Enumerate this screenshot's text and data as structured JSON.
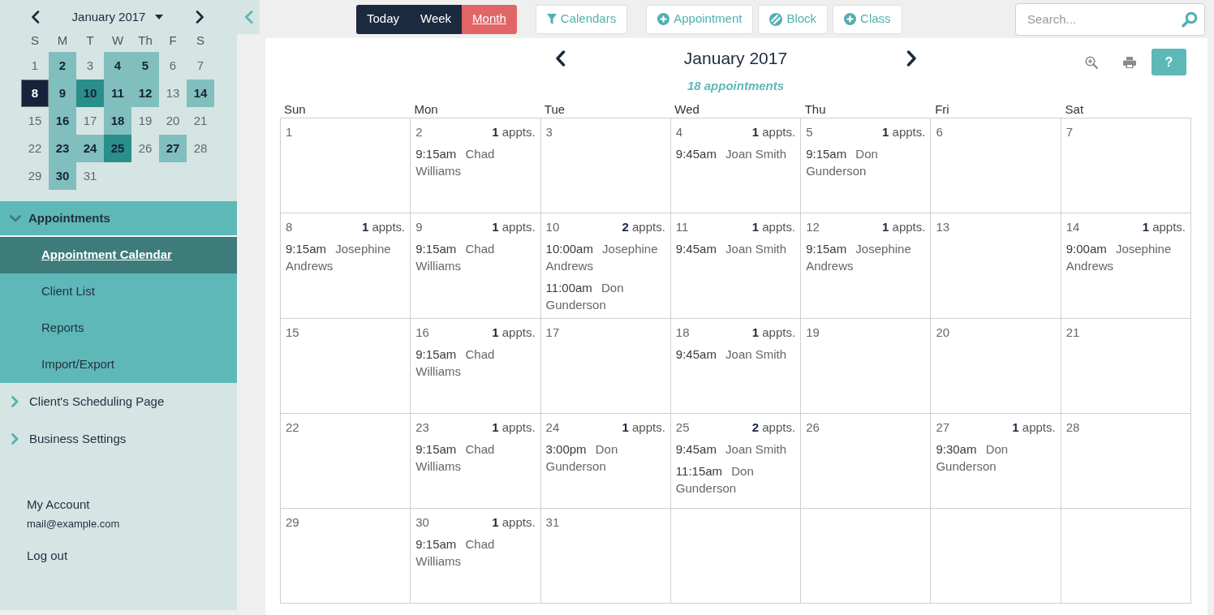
{
  "mini_calendar": {
    "title": "January 2017",
    "weekdays": [
      "S",
      "M",
      "T",
      "W",
      "Th",
      "F",
      "S"
    ],
    "days": [
      {
        "day": "1",
        "selected": false
      },
      {
        "day": "2",
        "selected": false,
        "color": "#80bfbd"
      },
      {
        "day": "3",
        "selected": false
      },
      {
        "day": "4",
        "selected": false,
        "color": "#80bfbd"
      },
      {
        "day": "5",
        "selected": false,
        "color": "#80bfbd"
      },
      {
        "day": "6",
        "selected": false
      },
      {
        "day": "7",
        "selected": false
      },
      {
        "day": "8",
        "selected": true
      },
      {
        "day": "9",
        "selected": false,
        "color": "#80bfbd"
      },
      {
        "day": "10",
        "selected": false,
        "color": "#2a8e8a"
      },
      {
        "day": "11",
        "selected": false,
        "color": "#80bfbd"
      },
      {
        "day": "12",
        "selected": false,
        "color": "#80bfbd"
      },
      {
        "day": "13",
        "selected": false
      },
      {
        "day": "14",
        "selected": false,
        "color": "#80bfbd"
      },
      {
        "day": "15",
        "selected": false
      },
      {
        "day": "16",
        "selected": false,
        "color": "#80bfbd"
      },
      {
        "day": "17",
        "selected": false
      },
      {
        "day": "18",
        "selected": false,
        "color": "#80bfbd"
      },
      {
        "day": "19",
        "selected": false
      },
      {
        "day": "20",
        "selected": false
      },
      {
        "day": "21",
        "selected": false
      },
      {
        "day": "22",
        "selected": false
      },
      {
        "day": "23",
        "selected": false,
        "color": "#80bfbd"
      },
      {
        "day": "24",
        "selected": false,
        "color": "#80bfbd"
      },
      {
        "day": "25",
        "selected": false,
        "color": "#2a8e8a"
      },
      {
        "day": "26",
        "selected": false
      },
      {
        "day": "27",
        "selected": false,
        "color": "#80bfbd"
      },
      {
        "day": "28",
        "selected": false
      },
      {
        "day": "29",
        "selected": false
      },
      {
        "day": "30",
        "selected": false,
        "color": "#80bfbd"
      },
      {
        "day": "31",
        "selected": false
      }
    ]
  },
  "sidebar": {
    "nav": [
      {
        "label": "Appointments",
        "expanded": true,
        "children": [
          {
            "label": "Appointment Calendar",
            "selected": true
          },
          {
            "label": "Client List",
            "selected": false
          },
          {
            "label": "Reports",
            "selected": false
          },
          {
            "label": "Import/Export",
            "selected": false
          }
        ]
      },
      {
        "label": "Client's Scheduling Page",
        "expanded": false
      },
      {
        "label": "Business Settings",
        "expanded": false
      }
    ],
    "account": {
      "label": "My Account",
      "email": "mail@example.com"
    },
    "logout": "Log out"
  },
  "toolbar": {
    "views": [
      {
        "label": "Today",
        "selected": false
      },
      {
        "label": "Week",
        "selected": false
      },
      {
        "label": "Month",
        "selected": true
      }
    ],
    "buttons": [
      {
        "label": "Calendars",
        "kind": "filter"
      },
      {
        "label": "Appointment",
        "kind": "add"
      },
      {
        "label": "Block",
        "kind": "block"
      },
      {
        "label": "Class",
        "kind": "add"
      }
    ],
    "search": {
      "placeholder": "Search..."
    }
  },
  "calendar": {
    "title": "January 2017",
    "summary": "18 appointments",
    "help": "?",
    "weekdays": [
      "Sun",
      "Mon",
      "Tue",
      "Wed",
      "Thu",
      "Fri",
      "Sat"
    ],
    "days": [
      {
        "day": "1"
      },
      {
        "day": "2",
        "count": "**1** appts.",
        "appointments": [
          {
            "time": "9:15am",
            "client": "Chad Williams"
          }
        ]
      },
      {
        "day": "3"
      },
      {
        "day": "4",
        "count": "**1** appts.",
        "appointments": [
          {
            "time": "9:45am",
            "client": "Joan Smith"
          }
        ]
      },
      {
        "day": "5",
        "count": "**1** appts.",
        "appointments": [
          {
            "time": "9:15am",
            "client": "Don Gunderson"
          }
        ]
      },
      {
        "day": "6"
      },
      {
        "day": "7"
      },
      {
        "day": "8",
        "count": "**1** appts.",
        "appointments": [
          {
            "time": "9:15am",
            "client": "Josephine Andrews"
          }
        ]
      },
      {
        "day": "9",
        "count": "**1** appts.",
        "appointments": [
          {
            "time": "9:15am",
            "client": "Chad Williams"
          }
        ]
      },
      {
        "day": "10",
        "count": "**2** appts.",
        "appointments": [
          {
            "time": "10:00am",
            "client": "Josephine Andrews"
          },
          {
            "time": "11:00am",
            "client": "Don Gunderson"
          }
        ]
      },
      {
        "day": "11",
        "count": "**1** appts.",
        "appointments": [
          {
            "time": "9:45am",
            "client": "Joan Smith"
          }
        ]
      },
      {
        "day": "12",
        "count": "**1** appts.",
        "appointments": [
          {
            "time": "9:15am",
            "client": "Josephine Andrews"
          }
        ]
      },
      {
        "day": "13"
      },
      {
        "day": "14",
        "count": "**1** appts.",
        "appointments": [
          {
            "time": "9:00am",
            "client": "Josephine Andrews"
          }
        ]
      },
      {
        "day": "15"
      },
      {
        "day": "16",
        "count": "**1** appts.",
        "appointments": [
          {
            "time": "9:15am",
            "client": "Chad Williams"
          }
        ]
      },
      {
        "day": "17"
      },
      {
        "day": "18",
        "count": "**1** appts.",
        "appointments": [
          {
            "time": "9:45am",
            "client": "Joan Smith"
          }
        ]
      },
      {
        "day": "19"
      },
      {
        "day": "20"
      },
      {
        "day": "21"
      },
      {
        "day": "22"
      },
      {
        "day": "23",
        "count": "**1** appts.",
        "appointments": [
          {
            "time": "9:15am",
            "client": "Chad Williams"
          }
        ]
      },
      {
        "day": "24",
        "count": "**1** appts.",
        "appointments": [
          {
            "time": "3:00pm",
            "client": "Don Gunderson"
          }
        ]
      },
      {
        "day": "25",
        "count": "**2** appts.",
        "appointments": [
          {
            "time": "9:45am",
            "client": "Joan Smith"
          },
          {
            "time": "11:15am",
            "client": "Don Gunderson"
          }
        ]
      },
      {
        "day": "26"
      },
      {
        "day": "27",
        "count": "**1** appts.",
        "appointments": [
          {
            "time": "9:30am",
            "client": "Don Gunderson"
          }
        ]
      },
      {
        "day": "28"
      },
      {
        "day": "29"
      },
      {
        "day": "30",
        "count": "**1** appts.",
        "appointments": [
          {
            "time": "9:15am",
            "client": "Chad Williams"
          }
        ]
      },
      {
        "day": "31"
      }
    ]
  }
}
